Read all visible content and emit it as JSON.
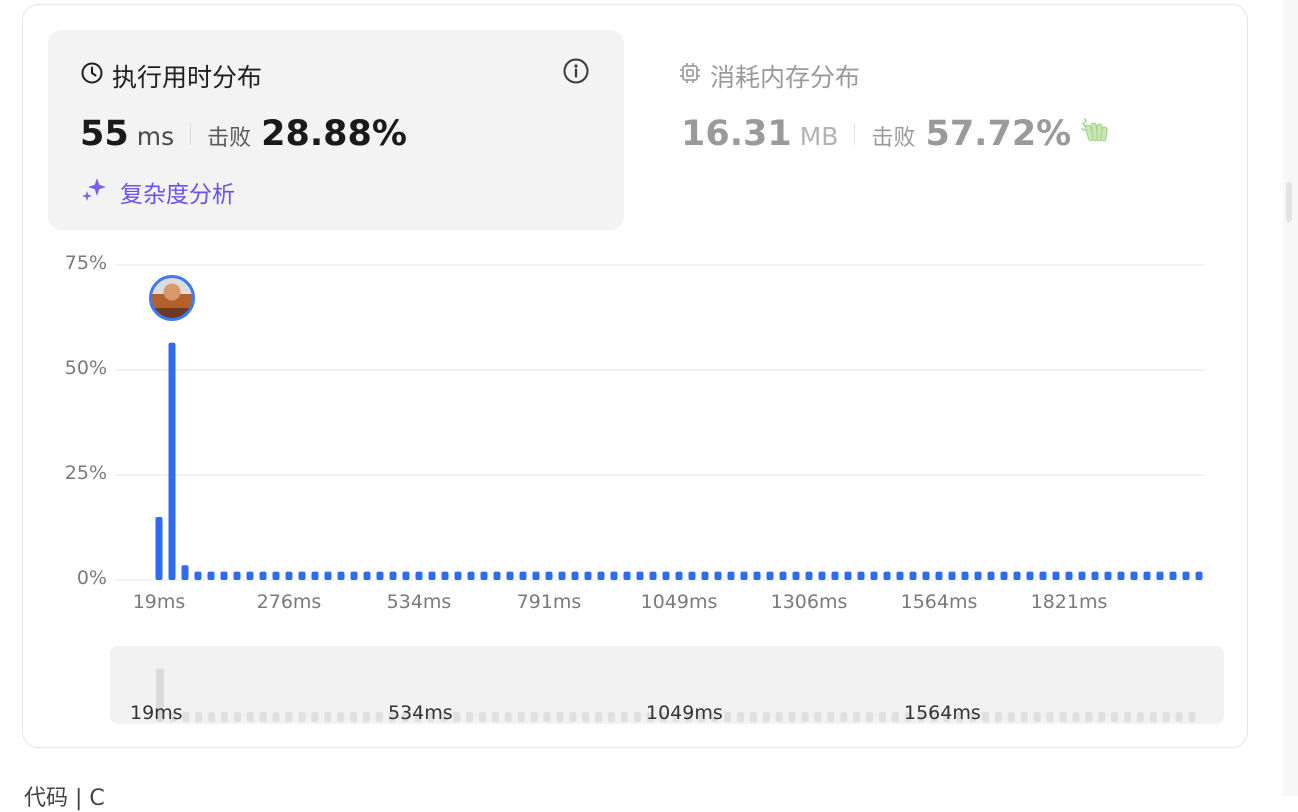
{
  "runtime": {
    "title": "执行用时分布",
    "value": "55",
    "unit": "ms",
    "beat_label": "击败",
    "beat_pct": "28.88%",
    "complexity_label": "复杂度分析"
  },
  "memory": {
    "title": "消耗内存分布",
    "value": "16.31",
    "unit": "MB",
    "beat_label": "击败",
    "beat_pct": "57.72%"
  },
  "icons": {
    "runtime": "clock-icon",
    "memory": "chip-icon",
    "info": "info-icon",
    "complexity": "sparkle-icon",
    "memory_extra": "clap-icon",
    "user": "avatar"
  },
  "colors": {
    "bar": "#2f6bf0",
    "accent_purple": "#6753f0",
    "card_bg": "#f3f3f3",
    "memory_text": "#9a9a9a"
  },
  "chart_data": {
    "type": "bar",
    "y_ticks": [
      "0%",
      "25%",
      "50%",
      "75%"
    ],
    "ylim": [
      0,
      75
    ],
    "x_ticks": [
      "19ms",
      "276ms",
      "534ms",
      "791ms",
      "1049ms",
      "1306ms",
      "1564ms",
      "1821ms"
    ],
    "values": [
      15,
      56.5,
      3.5,
      2,
      2,
      2,
      2,
      2,
      2,
      2,
      2,
      2,
      2,
      2,
      2,
      2,
      2,
      2,
      2,
      2,
      2,
      2,
      2,
      2,
      2,
      2,
      2,
      2,
      2,
      2,
      2,
      2,
      2,
      2,
      2,
      2,
      2,
      2,
      2,
      2,
      2,
      2,
      2,
      2,
      2,
      2,
      2,
      2,
      2,
      2,
      2,
      2,
      2,
      2,
      2,
      2,
      2,
      2,
      2,
      2,
      2,
      2,
      2,
      2,
      2,
      2,
      2,
      2,
      2,
      2,
      2,
      2,
      2,
      2,
      2,
      2,
      2,
      2,
      2,
      2,
      2
    ],
    "highlight_index": 1,
    "grid": true
  },
  "brush": {
    "ticks": [
      "19ms",
      "534ms",
      "1049ms",
      "1564ms"
    ]
  },
  "below_text": "代码 | C"
}
